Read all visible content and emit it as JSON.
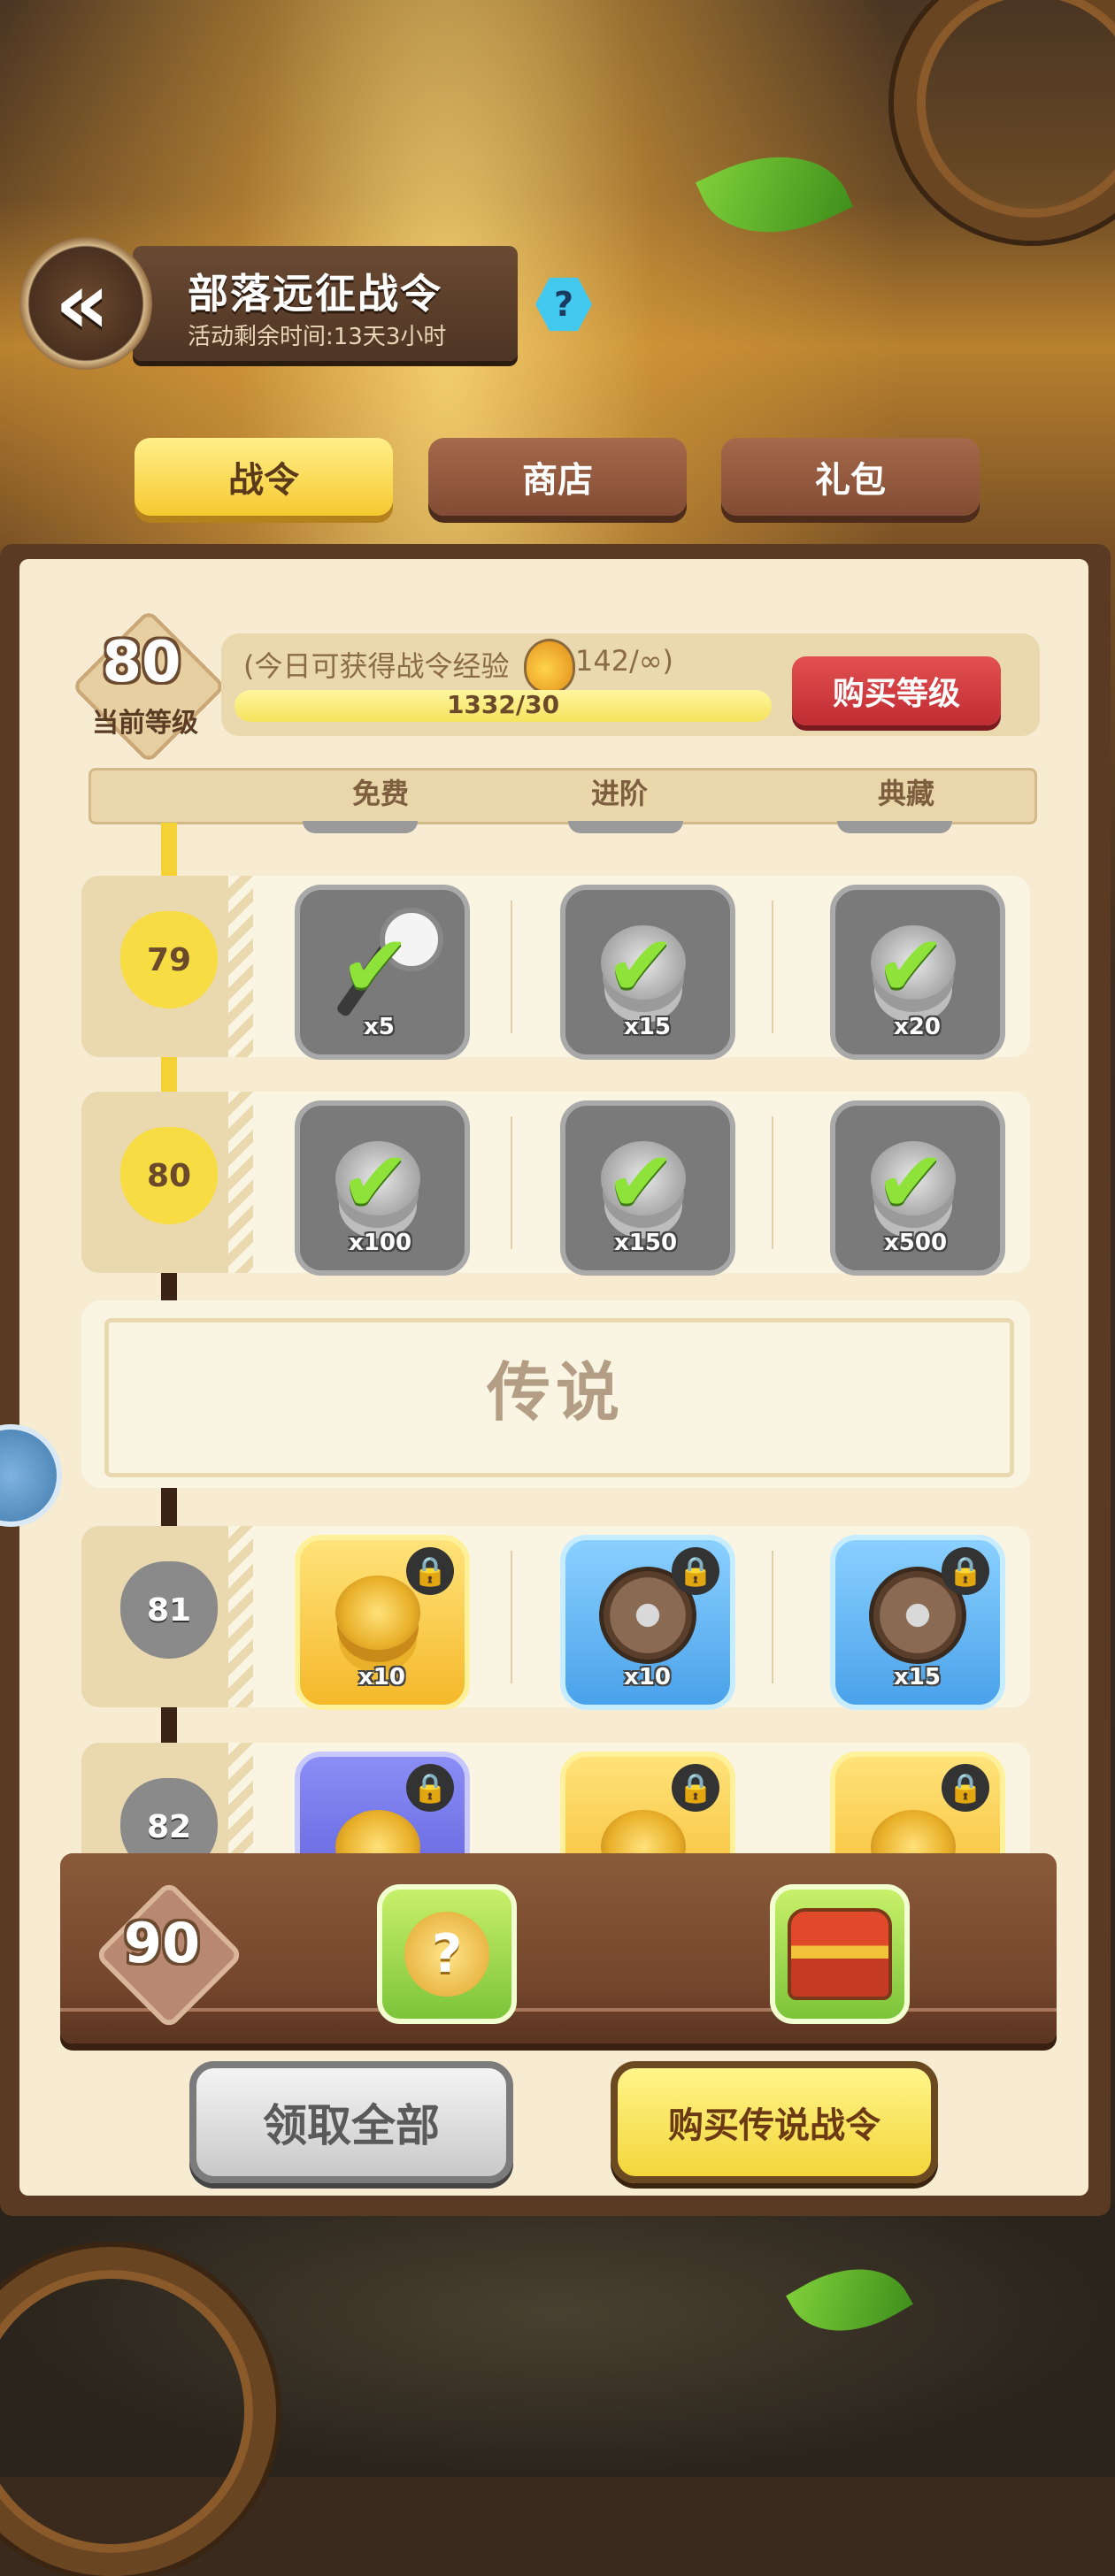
{
  "header": {
    "back_icon": "chevron-double-left-icon",
    "title": "部落远征战令",
    "subtitle": "活动剩余时间:13天3小时",
    "help_label": "?"
  },
  "tabs": [
    {
      "label": "战令",
      "active": true
    },
    {
      "label": "商店",
      "active": false
    },
    {
      "label": "礼包",
      "active": false
    }
  ],
  "status": {
    "current_level": "80",
    "current_level_label": "当前等级",
    "exp_text": "(今日可获得战令经验",
    "exp_limit": "142/∞)",
    "exp_progress_text": "1332/30",
    "exp_progress_fraction": 1.0,
    "buy_level_label": "购买等级"
  },
  "columns": [
    "免费",
    "进阶",
    "典藏"
  ],
  "rows": [
    {
      "level": "79",
      "reached": true,
      "rewards": [
        {
          "item": "wrench-icon",
          "qty": "x5",
          "state": "claimed"
        },
        {
          "item": "silver-coins-icon",
          "qty": "x15",
          "state": "claimed"
        },
        {
          "item": "silver-coins-icon",
          "qty": "x20",
          "state": "claimed"
        }
      ]
    },
    {
      "level": "80",
      "reached": true,
      "rewards": [
        {
          "item": "silver-coins-icon",
          "qty": "x100",
          "state": "claimed"
        },
        {
          "item": "silver-coins-icon",
          "qty": "x150",
          "state": "claimed"
        },
        {
          "item": "silver-coins-icon",
          "qty": "x500",
          "state": "claimed"
        }
      ]
    }
  ],
  "legend_banner": "传说",
  "locked_rows": [
    {
      "level": "81",
      "rewards": [
        {
          "item": "gold-coins-icon",
          "qty": "x10",
          "state": "locked",
          "tier": "gold"
        },
        {
          "item": "shield-icon",
          "qty": "x10",
          "state": "locked",
          "tier": "blue"
        },
        {
          "item": "shield-icon",
          "qty": "x15",
          "state": "locked",
          "tier": "blue"
        }
      ]
    },
    {
      "level": "82",
      "rewards": [
        {
          "item": "gold-coin-pile-icon",
          "qty": "",
          "state": "locked",
          "tier": "purple"
        },
        {
          "item": "gold-coins-icon",
          "qty": "",
          "state": "locked",
          "tier": "gold"
        },
        {
          "item": "gold-coins-icon",
          "qty": "",
          "state": "locked",
          "tier": "gold"
        }
      ]
    }
  ],
  "bottom_bar": {
    "target_level": "90",
    "reward_free": "mystery-orb-icon",
    "reward_premium": "treasure-chest-icon"
  },
  "actions": {
    "claim_all": "领取全部",
    "buy_legend": "购买传说战令"
  }
}
